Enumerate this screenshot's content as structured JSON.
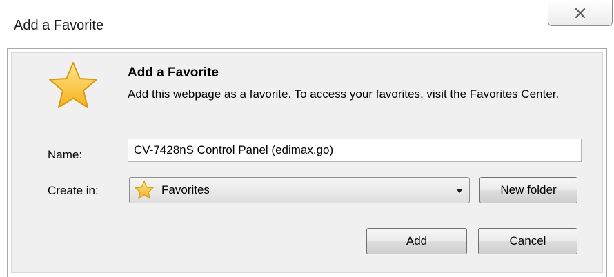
{
  "window": {
    "title": "Add a Favorite"
  },
  "header": {
    "heading": "Add a Favorite",
    "description": "Add this webpage as a favorite. To access your favorites, visit the Favorites Center."
  },
  "form": {
    "name_label": "Name:",
    "name_value": "CV-7428nS Control Panel (edimax.go)",
    "create_in_label": "Create in:",
    "create_in_value": "Favorites"
  },
  "buttons": {
    "new_folder": "New folder",
    "add": "Add",
    "cancel": "Cancel"
  },
  "icons": {
    "header_icon": "star-icon",
    "folder_icon": "star-icon",
    "close_icon": "close-icon",
    "dropdown_icon": "chevron-down-icon"
  },
  "colors": {
    "star_fill": "#fbc93a",
    "star_stroke": "#d89a12",
    "content_bg": "#f0f0f0"
  }
}
